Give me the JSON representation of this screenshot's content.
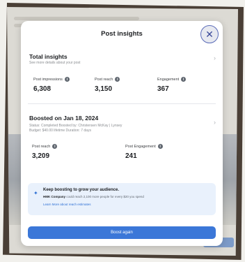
{
  "modal": {
    "title": "Post insights",
    "close_icon": "close-icon"
  },
  "total_insights": {
    "title": "Total insights",
    "subtitle": "See more details about your post",
    "metrics": [
      {
        "label": "Post impressions",
        "value": "6,308"
      },
      {
        "label": "Post reach",
        "value": "3,150"
      },
      {
        "label": "Engagement",
        "value": "367"
      }
    ]
  },
  "boosted": {
    "title": "Boosted on Jan 18, 2024",
    "status_line": "Status: Completed  Boosted by: Christensen McKay  |  Lynsey",
    "budget_line": "Budget: $40.00 lifetime  Duration: 7 days",
    "metrics": [
      {
        "label": "Post reach",
        "value": "3,209"
      },
      {
        "label": "Post Engagement",
        "value": "241"
      }
    ]
  },
  "tip": {
    "icon": "sparkle-icon",
    "title": "Keep boosting to grow your audience.",
    "company": "HMK Company",
    "body": " could reach 2,100 more people for every $20 you spend",
    "link": "Learn More about reach estimates"
  },
  "actions": {
    "boost_again": "Boost again"
  },
  "colors": {
    "accent": "#3b77d8",
    "tip_bg": "#e9f1fc"
  }
}
